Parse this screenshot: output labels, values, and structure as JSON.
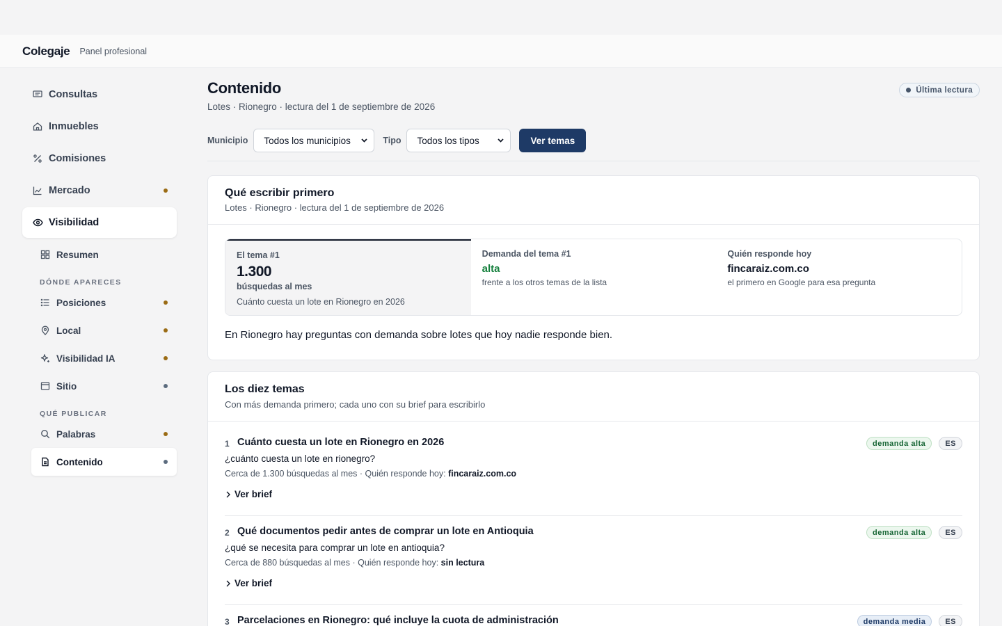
{
  "app": {
    "brand": "Colegaje",
    "subtitle": "Panel profesional"
  },
  "sidebar": {
    "top_items": [
      {
        "label": "Consultas",
        "icon": "message-icon",
        "dot": null
      },
      {
        "label": "Inmuebles",
        "icon": "home-icon",
        "dot": null
      },
      {
        "label": "Comisiones",
        "icon": "percent-icon",
        "dot": null
      },
      {
        "label": "Mercado",
        "icon": "chart-icon",
        "dot": "amber"
      },
      {
        "label": "Visibilidad",
        "icon": "eye-icon",
        "dot": null,
        "active": true
      }
    ],
    "sub_items": [
      {
        "label": "Resumen",
        "icon": "grid-icon",
        "dot": null
      },
      {
        "label": "Posiciones",
        "icon": "list-icon",
        "dot": "amber"
      },
      {
        "label": "Local",
        "icon": "pin-icon",
        "dot": "amber"
      },
      {
        "label": "Visibilidad IA",
        "icon": "sparkle-icon",
        "dot": "amber"
      },
      {
        "label": "Sitio",
        "icon": "browser-icon",
        "dot": "slate"
      },
      {
        "label": "Palabras",
        "icon": "search-icon",
        "dot": "amber"
      },
      {
        "label": "Contenido",
        "icon": "document-icon",
        "dot": "slate",
        "active": true
      }
    ],
    "section_donde": "DÓNDE APARECES",
    "section_que": "QUÉ PUBLICAR"
  },
  "page": {
    "title": "Contenido",
    "subtitle": "Lotes · Rionegro · lectura del 1 de septiembre de 2026",
    "badge": "Última lectura"
  },
  "filters": {
    "municipio_label": "Municipio",
    "municipio_value": "Todos los municipios",
    "tipo_label": "Tipo",
    "tipo_value": "Todos los tipos",
    "button": "Ver temas"
  },
  "first_card": {
    "title": "Qué escribir primero",
    "subtitle": "Lotes · Rionegro · lectura del 1 de septiembre de 2026",
    "metric1": {
      "label": "El tema #1",
      "value": "1.300",
      "unit": "búsquedas al mes",
      "note": "Cuánto cuesta un lote en Rionegro en 2026"
    },
    "metric2": {
      "label": "Demanda del tema #1",
      "value": "alta",
      "note": "frente a los otros temas de la lista"
    },
    "metric3": {
      "label": "Quién responde hoy",
      "value": "fincaraiz.com.co",
      "note": "el primero en Google para esa pregunta"
    },
    "body": "En Rionegro hay preguntas con demanda sobre lotes que hoy nadie responde bien."
  },
  "topics_card": {
    "title": "Los diez temas",
    "subtitle": "Con más demanda primero; cada uno con su brief para escribirlo",
    "brief_label": "Ver brief",
    "responder_prefix": "Quién responde hoy:",
    "topics": [
      {
        "num": "1",
        "title": "Cuánto cuesta un lote en Rionegro en 2026",
        "query": "¿cuánto cuesta un lote en rionegro?",
        "volume": "Cerca de 1.300 búsquedas al mes ·",
        "responder": "fincaraiz.com.co",
        "demand": "demanda alta",
        "lang": "ES"
      },
      {
        "num": "2",
        "title": "Qué documentos pedir antes de comprar un lote en Antioquia",
        "query": "¿qué se necesita para comprar un lote en antioquia?",
        "volume": "Cerca de 880 búsquedas al mes ·",
        "responder": "sin lectura",
        "demand": "demanda alta",
        "lang": "ES"
      },
      {
        "num": "3",
        "title": "Parcelaciones en Rionegro: qué incluye la cuota de administración",
        "demand": "demanda media",
        "lang": "ES"
      }
    ]
  }
}
